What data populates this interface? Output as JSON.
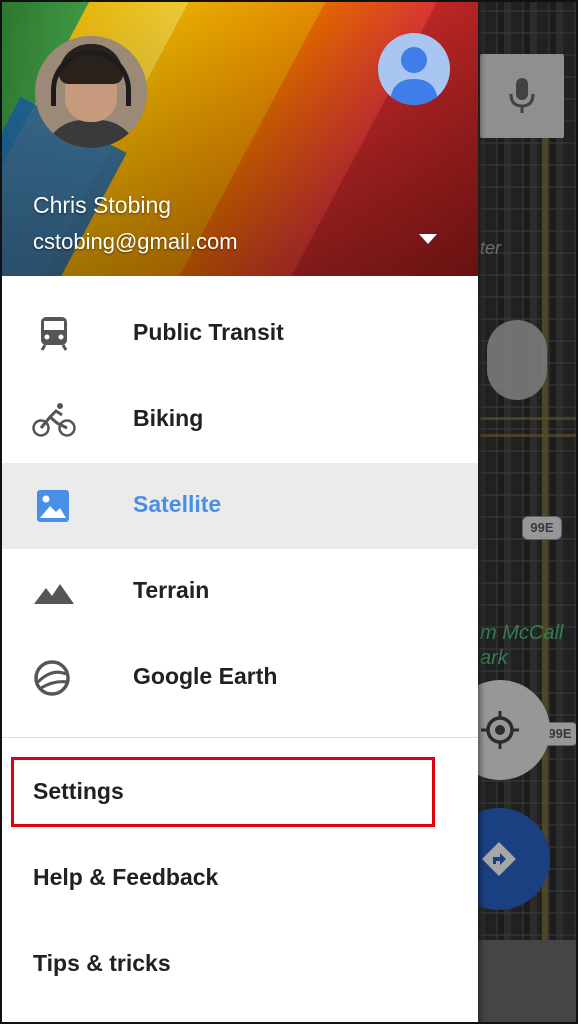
{
  "account": {
    "name": "Chris Stobing",
    "email": "cstobing@gmail.com"
  },
  "menu": {
    "layers": [
      {
        "id": "public-transit",
        "label": "Public Transit",
        "icon": "train-icon",
        "selected": false
      },
      {
        "id": "biking",
        "label": "Biking",
        "icon": "bike-icon",
        "selected": false
      },
      {
        "id": "satellite",
        "label": "Satellite",
        "icon": "satellite-image-icon",
        "selected": true
      },
      {
        "id": "terrain",
        "label": "Terrain",
        "icon": "mountain-icon",
        "selected": false
      },
      {
        "id": "google-earth",
        "label": "Google Earth",
        "icon": "globe-icon",
        "selected": false
      }
    ],
    "settings_label": "Settings",
    "help_label": "Help & Feedback",
    "tips_label": "Tips & tricks"
  },
  "map": {
    "labels": {
      "ter": "ter",
      "mccall": "m McCall",
      "park": "ark"
    },
    "shields": [
      "99E",
      "99E"
    ]
  },
  "colors": {
    "accent_selected": "#4a8fe7",
    "highlight_border": "#e0000f",
    "fab_directions": "#2a63c8"
  }
}
